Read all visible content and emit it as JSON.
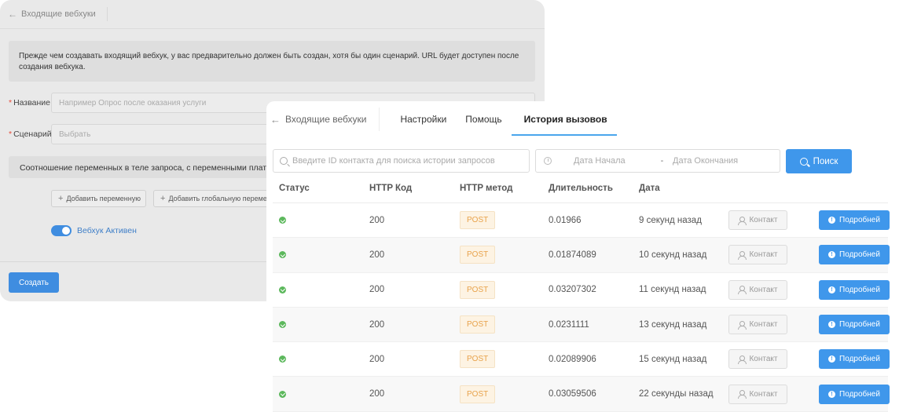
{
  "back_panel": {
    "title": "Входящие вебхуки",
    "note": "Прежде чем создавать входящий вебхук, у вас предварительно должен быть создан, хотя бы один сценарий. URL будет доступен после создания вебхука.",
    "name_label": "Название",
    "name_placeholder": "Например Опрос после оказания услуги",
    "scenario_label": "Сценарий",
    "scenario_placeholder": "Выбрать",
    "mapping_text": "Соотношение переменных в теле запроса, с переменными платформы",
    "add_variable": "Добавить переменную",
    "add_global_variable": "Добавить глобальную переменную",
    "toggle_label": "Вебхук Активен",
    "create_button": "Создать"
  },
  "front_panel": {
    "back_title": "Входящие вебхуки",
    "tabs": [
      {
        "label": "Настройки"
      },
      {
        "label": "Помощь"
      },
      {
        "label": "История вызовов"
      }
    ],
    "search_placeholder": "Введите ID контакта для поиска истории запросов",
    "date_start": "Дата Начала",
    "date_separator": "-",
    "date_end": "Дата Окончания",
    "search_button": "Поиск",
    "columns": [
      "Статус",
      "HTTP Код",
      "HTTP метод",
      "Длительность",
      "Дата"
    ],
    "rows": [
      {
        "code": "200",
        "method": "POST",
        "duration": "0.01966",
        "date": "9 секунд назад",
        "contact": "Контакт",
        "details": "Подробней"
      },
      {
        "code": "200",
        "method": "POST",
        "duration": "0.01874089",
        "date": "10 секунд назад",
        "contact": "Контакт",
        "details": "Подробней"
      },
      {
        "code": "200",
        "method": "POST",
        "duration": "0.03207302",
        "date": "11 секунд назад",
        "contact": "Контакт",
        "details": "Подробней"
      },
      {
        "code": "200",
        "method": "POST",
        "duration": "0.0231111",
        "date": "13 секунд назад",
        "contact": "Контакт",
        "details": "Подробней"
      },
      {
        "code": "200",
        "method": "POST",
        "duration": "0.02089906",
        "date": "15 секунд назад",
        "contact": "Контакт",
        "details": "Подробней"
      },
      {
        "code": "200",
        "method": "POST",
        "duration": "0.03059506",
        "date": "22 секунды назад",
        "contact": "Контакт",
        "details": "Подробней"
      }
    ]
  },
  "colors": {
    "primary": "#3f97eb",
    "success": "#5cb85c",
    "post_badge": "#e8a24a",
    "active_tab_underline": "#4aa6ec"
  }
}
